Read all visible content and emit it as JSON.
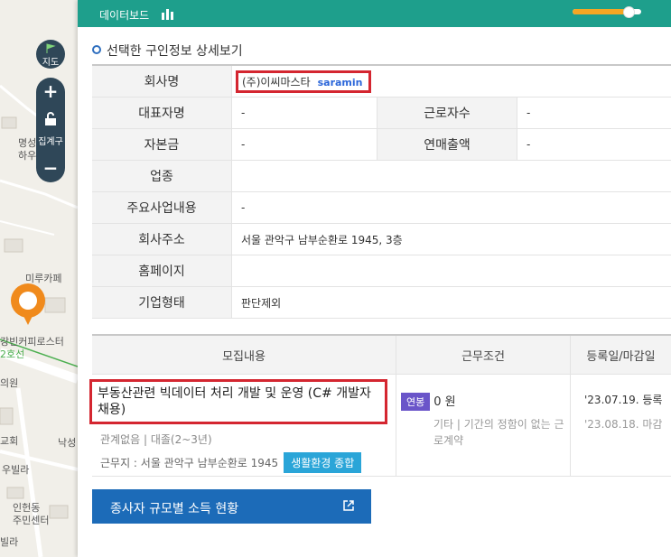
{
  "map": {
    "labels": [
      "명성",
      "하우",
      "미루카페",
      "강빈커피로스터",
      "2호선",
      "의원",
      "교회",
      "낙성",
      "우빌라",
      "인헌동",
      "주민센터",
      "빌라"
    ],
    "map_button": "지도",
    "aggregate_button": "집계구",
    "zoom_in": "+",
    "zoom_out": "−"
  },
  "topbar": {
    "title": "데이터보드",
    "progress_value": 0.8
  },
  "detail": {
    "section_title": "선택한 구인정보 상세보기",
    "company_label": "회사명",
    "company_value": "(주)이씨마스타",
    "company_source": "saramin",
    "ceo_label": "대표자명",
    "ceo_value": "-",
    "employees_label": "근로자수",
    "employees_value": "-",
    "capital_label": "자본금",
    "capital_value": "-",
    "sales_label": "연매출액",
    "sales_value": "-",
    "industry_label": "업종",
    "industry_value": "",
    "business_label": "주요사업내용",
    "business_value": "-",
    "address_label": "회사주소",
    "address_value": "서울 관악구 남부순환로 1945, 3층",
    "homepage_label": "홈페이지",
    "homepage_value": "",
    "type_label": "기업형태",
    "type_value": "판단제외"
  },
  "jobs": {
    "headers": [
      "모집내용",
      "근무조건",
      "등록일/마감일"
    ],
    "rows": [
      {
        "title": "부동산관련 빅데이터 처리 개발 및 운영 (C# 개발자 채용)",
        "requirements": "관계없음 | 대졸(2~3년)",
        "location": "근무지 : 서울 관악구 남부순환로 1945",
        "tag": "생활환경 종합",
        "wage_type": "연봉",
        "wage": "0 원",
        "condition_note": "기타 | 기간의 정함이 없는 근로계약",
        "registered": "'23.07.19. 등록",
        "deadline": "'23.08.18. 마감"
      }
    ]
  },
  "income_button": "종사자 규모별 소득 현황"
}
